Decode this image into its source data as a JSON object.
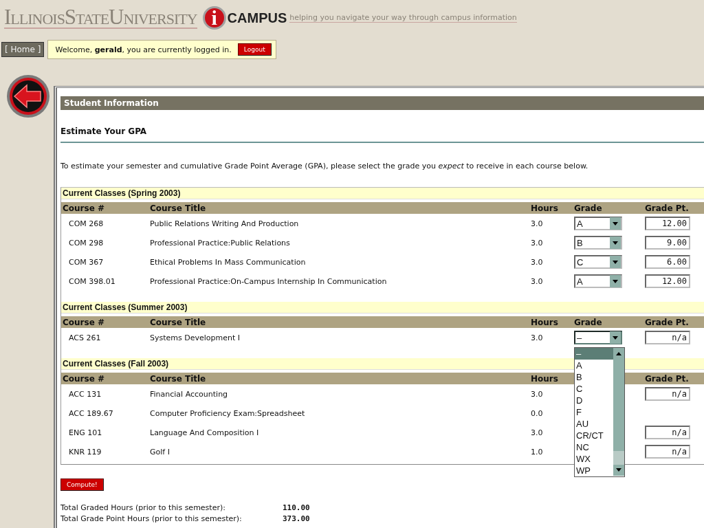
{
  "header": {
    "university": "IllinoisStateUniversity",
    "logo_mark": "i",
    "logo_word": "CAMPUS",
    "tagline": "helping you navigate your way through campus information"
  },
  "nav": {
    "home": "[ Home ]",
    "welcome": "Welcome, **gerald**, you are currently logged in.",
    "logout": "Logout"
  },
  "section_title": "Student Information",
  "heading": "Estimate Your GPA",
  "intro": "To estimate your semester and cumulative Grade Point Average (GPA), please select the grade you *expect* to receive in each course below.",
  "terms": [
    {
      "title": "Current Classes (Spring 2003)",
      "columns": [
        {
          "kind": "course",
          "label": "Course #"
        },
        {
          "kind": "title",
          "label": "Course Title"
        },
        {
          "kind": "hours",
          "label": "Hours"
        },
        {
          "kind": "grade",
          "label": "Grade"
        },
        {
          "kind": "points",
          "label": "Grade Pt."
        }
      ],
      "rows": [
        {
          "course": "COM 268",
          "title": "Public Relations Writing And Production",
          "hours": "3.0",
          "grade": {
            "value": "A",
            "open": false
          },
          "grade_pt": "12.00"
        },
        {
          "course": "COM 298",
          "title": "Professional Practice:Public Relations",
          "hours": "3.0",
          "grade": {
            "value": "B",
            "open": false
          },
          "grade_pt": "9.00"
        },
        {
          "course": "COM 367",
          "title": "Ethical Problems In Mass Communication",
          "hours": "3.0",
          "grade": {
            "value": "C",
            "open": false
          },
          "grade_pt": "6.00"
        },
        {
          "course": "COM 398.01",
          "title": "Professional Practice:On-Campus Internship In Communication",
          "hours": "3.0",
          "grade": {
            "value": "A",
            "open": false
          },
          "grade_pt": "12.00"
        }
      ]
    },
    {
      "title": "Current Classes (Summer 2003)",
      "columns": [
        {
          "kind": "course",
          "label": "Course #"
        },
        {
          "kind": "title",
          "label": "Course Title"
        },
        {
          "kind": "hours",
          "label": "Hours"
        },
        {
          "kind": "grade",
          "label": "Grade"
        },
        {
          "kind": "points",
          "label": "Grade Pt."
        }
      ],
      "rows": [
        {
          "course": "ACS 261",
          "title": "Systems Development I",
          "hours": "3.0",
          "grade": {
            "value": "–",
            "open": true,
            "options": [
              {
                "label": "–",
                "selected": true
              },
              {
                "label": "A",
                "selected": false
              },
              {
                "label": "B",
                "selected": false
              },
              {
                "label": "C",
                "selected": false
              },
              {
                "label": "D",
                "selected": false
              },
              {
                "label": "F",
                "selected": false
              },
              {
                "label": "AU",
                "selected": false
              },
              {
                "label": "CR/CT",
                "selected": false
              },
              {
                "label": "NC",
                "selected": false
              },
              {
                "label": "WX",
                "selected": false
              },
              {
                "label": "WP",
                "selected": false
              }
            ]
          },
          "grade_pt": "n/a"
        }
      ]
    },
    {
      "title": "Current Classes (Fall 2003)",
      "columns": [
        {
          "kind": "course",
          "label": "Course #"
        },
        {
          "kind": "title",
          "label": "Course Title"
        },
        {
          "kind": "hours",
          "label": "Hours"
        },
        {
          "kind": "points",
          "label": "Grade Pt."
        }
      ],
      "rows": [
        {
          "course": "ACC 131",
          "title": "Financial Accounting",
          "hours": "3.0",
          "grade_pt": "n/a"
        },
        {
          "course": "ACC 189.67",
          "title": "Computer Proficiency Exam:Spreadsheet",
          "hours": "0.0"
        },
        {
          "course": "ENG 101",
          "title": "Language And Composition I",
          "hours": "3.0",
          "grade_pt": "n/a"
        },
        {
          "course": "KNR 119",
          "title": "Golf I",
          "hours": "1.0",
          "grade_pt": "n/a"
        }
      ]
    }
  ],
  "compute": "Compute!",
  "totals": [
    {
      "label": "Total Graded Hours (prior to this semester):",
      "value": "110.00"
    },
    {
      "label": "Total Grade Point Hours (prior to this semester):",
      "value": "373.00"
    }
  ]
}
